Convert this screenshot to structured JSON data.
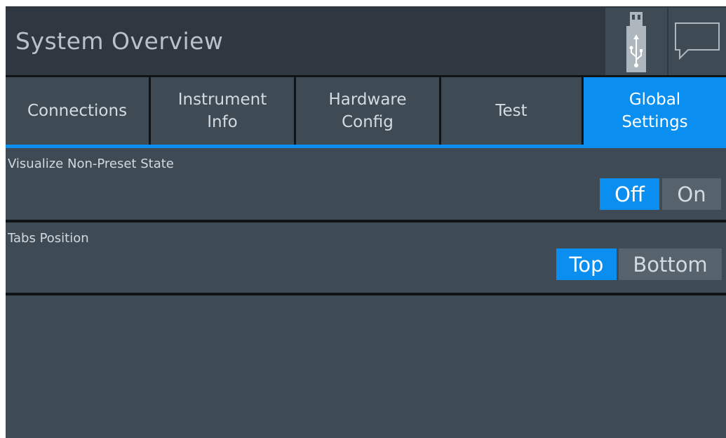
{
  "window": {
    "title": "System Overview"
  },
  "toolbar": {
    "usb": {
      "icon": "usb-icon"
    },
    "messages": {
      "icon": "message-icon"
    }
  },
  "tabs": [
    {
      "label": "Connections",
      "active": false
    },
    {
      "label": "Instrument\nInfo",
      "active": false
    },
    {
      "label": "Hardware\nConfig",
      "active": false
    },
    {
      "label": "Test",
      "active": false
    },
    {
      "label": "Global\nSettings",
      "active": true
    }
  ],
  "settings": {
    "visualize": {
      "label": "Visualize Non-Preset State",
      "options": [
        "Off",
        "On"
      ],
      "selected": "Off"
    },
    "tabs_position": {
      "label": "Tabs Position",
      "options": [
        "Top",
        "Bottom"
      ],
      "selected": "Top"
    }
  },
  "colors": {
    "accent": "#0a8ff0",
    "background": "#2f3840",
    "panel": "#3e4b55",
    "inactive_option": "#56636d"
  }
}
